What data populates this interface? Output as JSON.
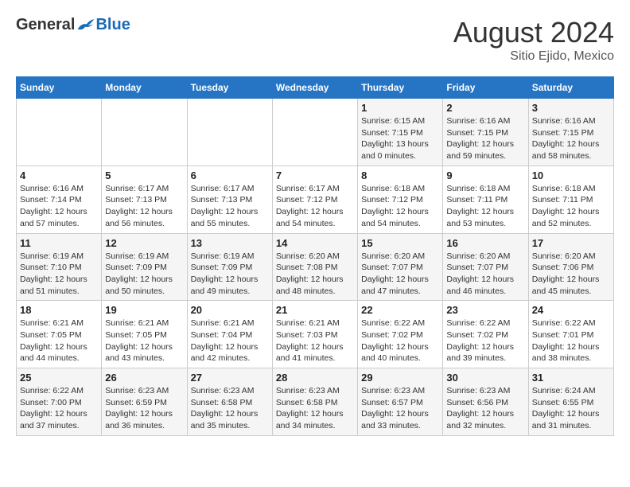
{
  "header": {
    "logo": {
      "general": "General",
      "blue": "Blue"
    },
    "title": "August 2024",
    "subtitle": "Sitio Ejido, Mexico"
  },
  "calendar": {
    "days_of_week": [
      "Sunday",
      "Monday",
      "Tuesday",
      "Wednesday",
      "Thursday",
      "Friday",
      "Saturday"
    ],
    "weeks": [
      [
        {
          "day": "",
          "info": ""
        },
        {
          "day": "",
          "info": ""
        },
        {
          "day": "",
          "info": ""
        },
        {
          "day": "",
          "info": ""
        },
        {
          "day": "1",
          "info": "Sunrise: 6:15 AM\nSunset: 7:15 PM\nDaylight: 13 hours\nand 0 minutes."
        },
        {
          "day": "2",
          "info": "Sunrise: 6:16 AM\nSunset: 7:15 PM\nDaylight: 12 hours\nand 59 minutes."
        },
        {
          "day": "3",
          "info": "Sunrise: 6:16 AM\nSunset: 7:15 PM\nDaylight: 12 hours\nand 58 minutes."
        }
      ],
      [
        {
          "day": "4",
          "info": "Sunrise: 6:16 AM\nSunset: 7:14 PM\nDaylight: 12 hours\nand 57 minutes."
        },
        {
          "day": "5",
          "info": "Sunrise: 6:17 AM\nSunset: 7:13 PM\nDaylight: 12 hours\nand 56 minutes."
        },
        {
          "day": "6",
          "info": "Sunrise: 6:17 AM\nSunset: 7:13 PM\nDaylight: 12 hours\nand 55 minutes."
        },
        {
          "day": "7",
          "info": "Sunrise: 6:17 AM\nSunset: 7:12 PM\nDaylight: 12 hours\nand 54 minutes."
        },
        {
          "day": "8",
          "info": "Sunrise: 6:18 AM\nSunset: 7:12 PM\nDaylight: 12 hours\nand 54 minutes."
        },
        {
          "day": "9",
          "info": "Sunrise: 6:18 AM\nSunset: 7:11 PM\nDaylight: 12 hours\nand 53 minutes."
        },
        {
          "day": "10",
          "info": "Sunrise: 6:18 AM\nSunset: 7:11 PM\nDaylight: 12 hours\nand 52 minutes."
        }
      ],
      [
        {
          "day": "11",
          "info": "Sunrise: 6:19 AM\nSunset: 7:10 PM\nDaylight: 12 hours\nand 51 minutes."
        },
        {
          "day": "12",
          "info": "Sunrise: 6:19 AM\nSunset: 7:09 PM\nDaylight: 12 hours\nand 50 minutes."
        },
        {
          "day": "13",
          "info": "Sunrise: 6:19 AM\nSunset: 7:09 PM\nDaylight: 12 hours\nand 49 minutes."
        },
        {
          "day": "14",
          "info": "Sunrise: 6:20 AM\nSunset: 7:08 PM\nDaylight: 12 hours\nand 48 minutes."
        },
        {
          "day": "15",
          "info": "Sunrise: 6:20 AM\nSunset: 7:07 PM\nDaylight: 12 hours\nand 47 minutes."
        },
        {
          "day": "16",
          "info": "Sunrise: 6:20 AM\nSunset: 7:07 PM\nDaylight: 12 hours\nand 46 minutes."
        },
        {
          "day": "17",
          "info": "Sunrise: 6:20 AM\nSunset: 7:06 PM\nDaylight: 12 hours\nand 45 minutes."
        }
      ],
      [
        {
          "day": "18",
          "info": "Sunrise: 6:21 AM\nSunset: 7:05 PM\nDaylight: 12 hours\nand 44 minutes."
        },
        {
          "day": "19",
          "info": "Sunrise: 6:21 AM\nSunset: 7:05 PM\nDaylight: 12 hours\nand 43 minutes."
        },
        {
          "day": "20",
          "info": "Sunrise: 6:21 AM\nSunset: 7:04 PM\nDaylight: 12 hours\nand 42 minutes."
        },
        {
          "day": "21",
          "info": "Sunrise: 6:21 AM\nSunset: 7:03 PM\nDaylight: 12 hours\nand 41 minutes."
        },
        {
          "day": "22",
          "info": "Sunrise: 6:22 AM\nSunset: 7:02 PM\nDaylight: 12 hours\nand 40 minutes."
        },
        {
          "day": "23",
          "info": "Sunrise: 6:22 AM\nSunset: 7:02 PM\nDaylight: 12 hours\nand 39 minutes."
        },
        {
          "day": "24",
          "info": "Sunrise: 6:22 AM\nSunset: 7:01 PM\nDaylight: 12 hours\nand 38 minutes."
        }
      ],
      [
        {
          "day": "25",
          "info": "Sunrise: 6:22 AM\nSunset: 7:00 PM\nDaylight: 12 hours\nand 37 minutes."
        },
        {
          "day": "26",
          "info": "Sunrise: 6:23 AM\nSunset: 6:59 PM\nDaylight: 12 hours\nand 36 minutes."
        },
        {
          "day": "27",
          "info": "Sunrise: 6:23 AM\nSunset: 6:58 PM\nDaylight: 12 hours\nand 35 minutes."
        },
        {
          "day": "28",
          "info": "Sunrise: 6:23 AM\nSunset: 6:58 PM\nDaylight: 12 hours\nand 34 minutes."
        },
        {
          "day": "29",
          "info": "Sunrise: 6:23 AM\nSunset: 6:57 PM\nDaylight: 12 hours\nand 33 minutes."
        },
        {
          "day": "30",
          "info": "Sunrise: 6:23 AM\nSunset: 6:56 PM\nDaylight: 12 hours\nand 32 minutes."
        },
        {
          "day": "31",
          "info": "Sunrise: 6:24 AM\nSunset: 6:55 PM\nDaylight: 12 hours\nand 31 minutes."
        }
      ]
    ]
  }
}
